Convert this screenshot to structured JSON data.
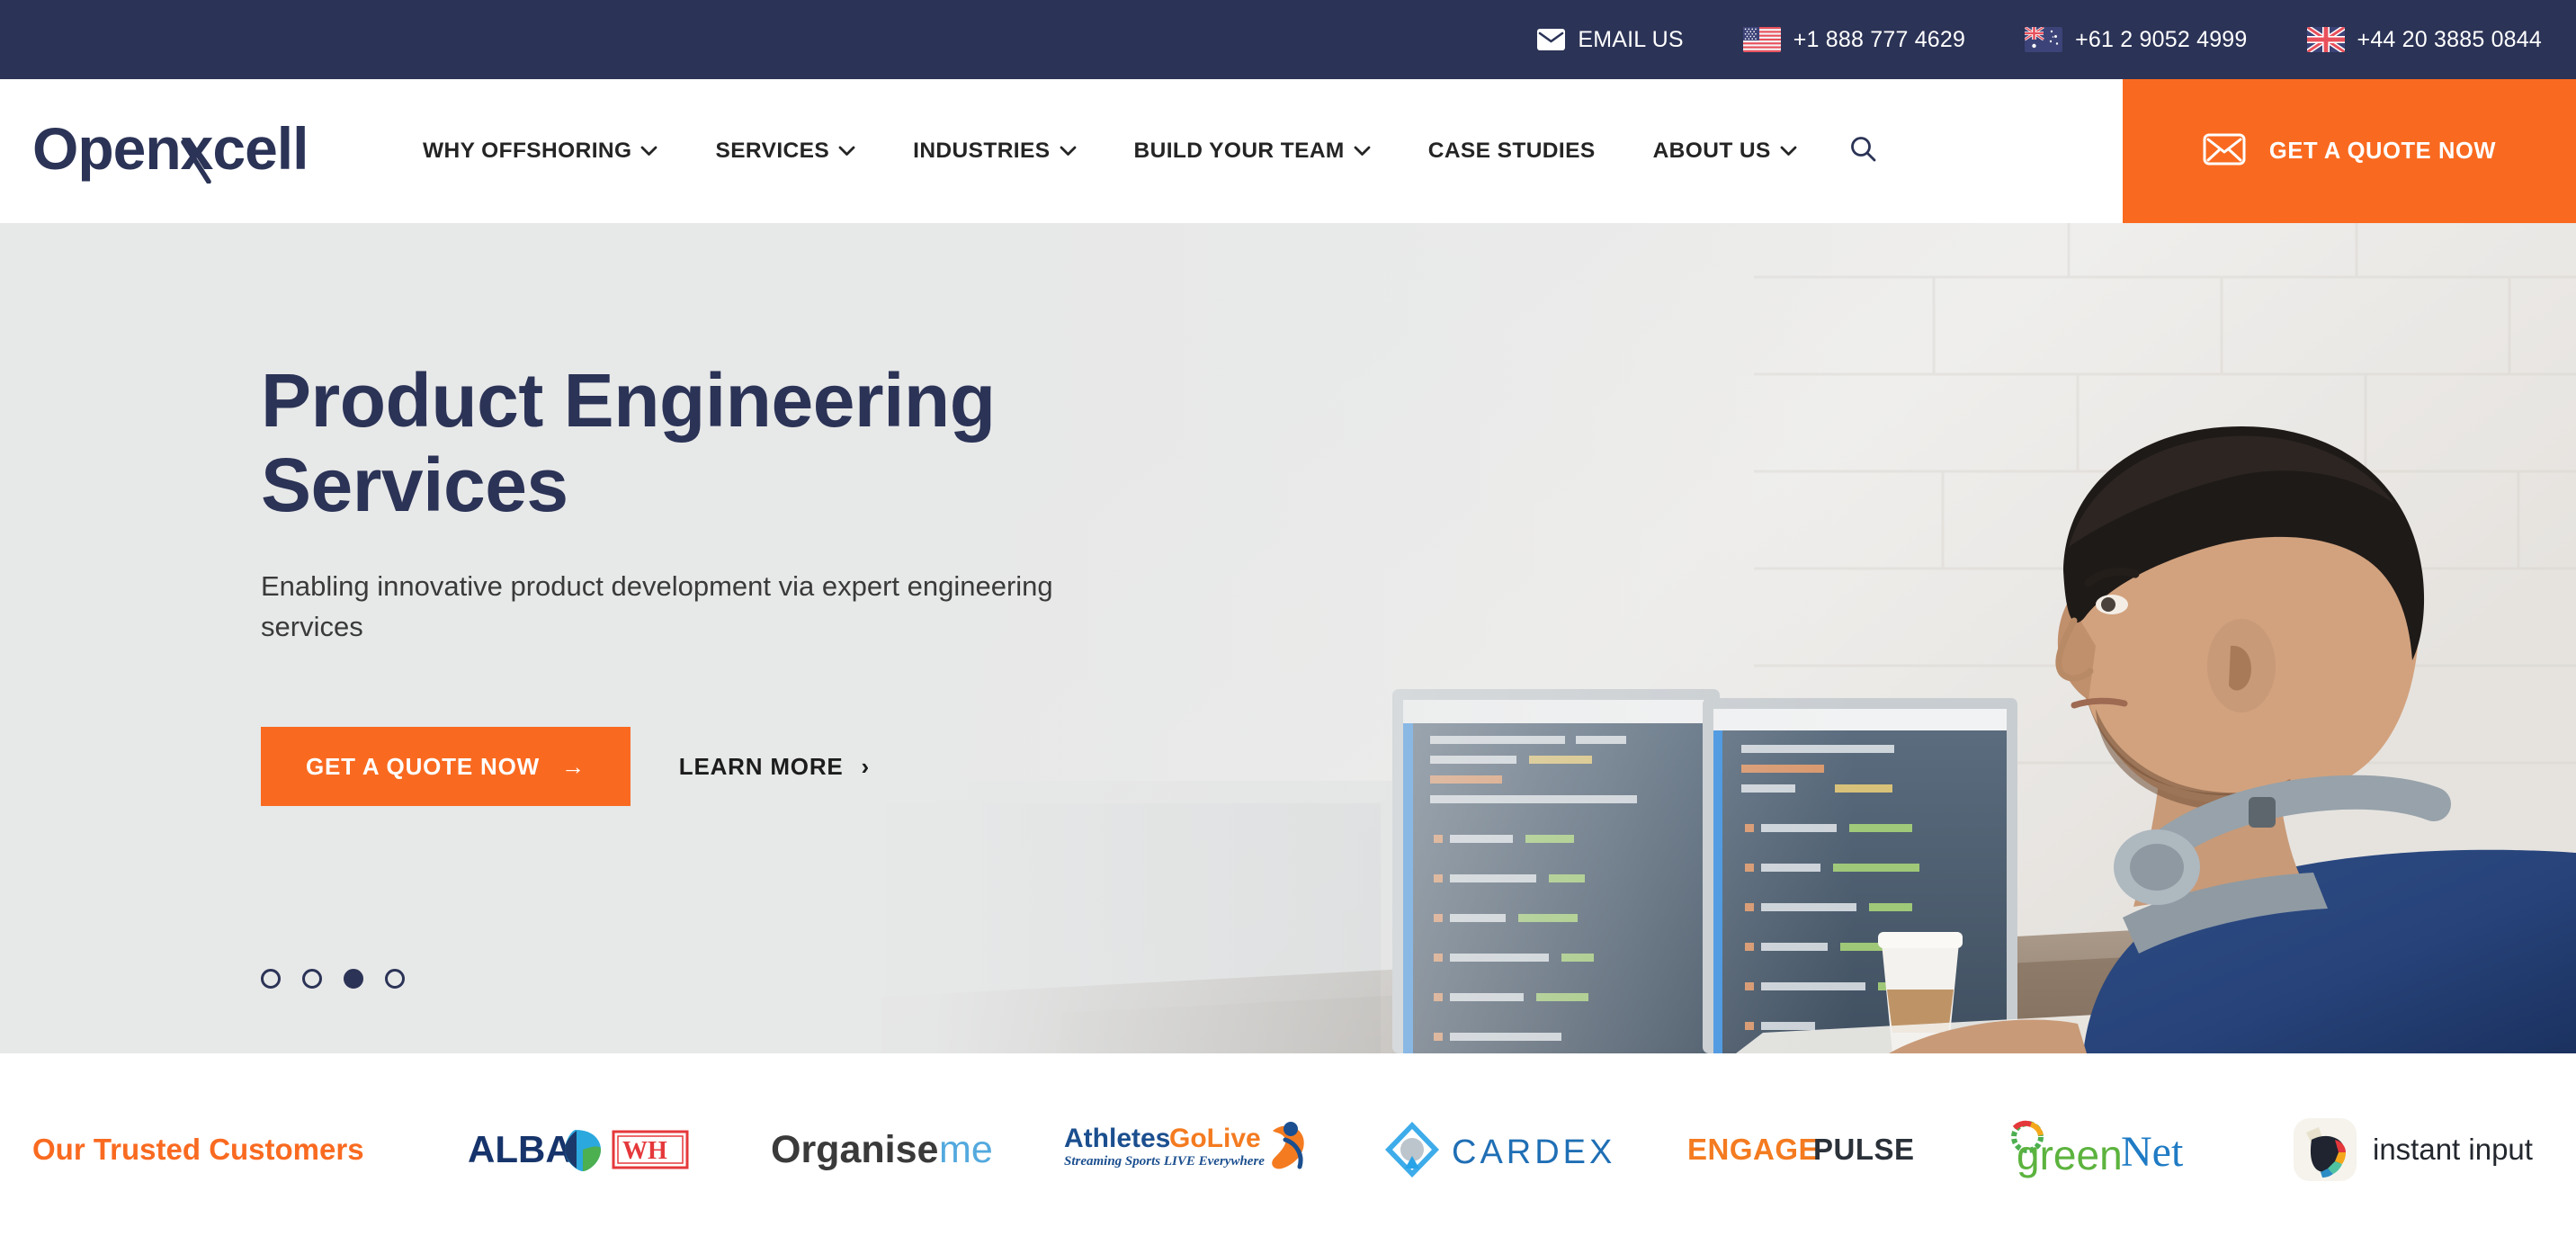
{
  "topbar": {
    "items": [
      {
        "icon": "envelope-icon",
        "label": "EMAIL US",
        "name": "email-us"
      },
      {
        "icon": "flag-us-icon",
        "label": "+1 888 777 4629",
        "name": "phone-us"
      },
      {
        "icon": "flag-au-icon",
        "label": "+61 2 9052 4999",
        "name": "phone-au"
      },
      {
        "icon": "flag-uk-icon",
        "label": "+44 20 3885 0844",
        "name": "phone-uk"
      }
    ],
    "background": "#2B3356"
  },
  "header": {
    "logo_text": "Openxcell",
    "nav": [
      {
        "label": "WHY OFFSHORING",
        "has_dropdown": true
      },
      {
        "label": "SERVICES",
        "has_dropdown": true
      },
      {
        "label": "INDUSTRIES",
        "has_dropdown": true
      },
      {
        "label": "BUILD YOUR TEAM",
        "has_dropdown": true
      },
      {
        "label": "CASE STUDIES",
        "has_dropdown": false
      },
      {
        "label": "ABOUT US",
        "has_dropdown": true
      }
    ],
    "search_icon": "search-icon",
    "cta": {
      "label": "GET A QUOTE NOW",
      "icon": "envelope-outline-icon",
      "color": "#F96A20"
    }
  },
  "hero": {
    "title_line1": "Product Engineering",
    "title_line2": "Services",
    "subtitle": "Enabling innovative product development via expert engineering services",
    "primary_cta": {
      "label": "GET A QUOTE NOW",
      "arrow": "→"
    },
    "secondary_cta": {
      "label": "LEARN MORE",
      "arrow": "›"
    },
    "slider": {
      "total": 4,
      "active_index": 2
    },
    "title_color": "#2B3356",
    "background": "#E7E8E8"
  },
  "customers": {
    "title": "Our Trusted Customers",
    "title_color": "#F96A20",
    "logos": [
      {
        "name": "alba",
        "text": "ALBA",
        "secondary": "WH"
      },
      {
        "name": "organiseme",
        "text": "Organise",
        "secondary": "me"
      },
      {
        "name": "athletesgolive",
        "text": "AthletesGoLive",
        "tagline": "Streaming Sports LIVE Everywhere"
      },
      {
        "name": "cardex",
        "text": "CARDEX"
      },
      {
        "name": "engagepulse",
        "text": "ENGAGE",
        "secondary": "PULSE"
      },
      {
        "name": "greennet",
        "text": "green",
        "secondary": "Net"
      },
      {
        "name": "instant-input",
        "text": "instant input"
      }
    ]
  }
}
